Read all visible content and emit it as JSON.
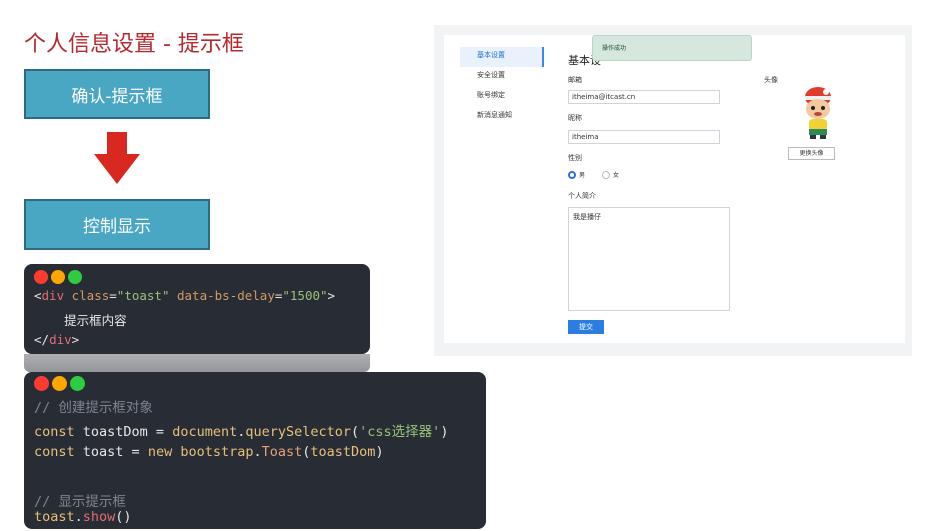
{
  "slide": {
    "title": "个人信息设置 - 提示框",
    "flow_step_1": "确认-提示框",
    "flow_step_2": "控制显示"
  },
  "code_html": {
    "line1_open": "<",
    "line1_tag": "div",
    "line1_attr1": " class",
    "line1_eq1": "=",
    "line1_val1": "\"toast\"",
    "line1_attr2": " data-bs-delay",
    "line1_eq2": "=",
    "line1_val2": "\"1500\"",
    "line1_close": ">",
    "line2": "    提示框内容",
    "line3_open": "</",
    "line3_tag": "div",
    "line3_close": ">"
  },
  "code_js": {
    "comment1": "// 创建提示框对象",
    "l2_kw": "const",
    "l2_var": " toastDom",
    "l2_eq": " = ",
    "l2_obj": "document",
    "l2_dot": ".",
    "l2_fn": "querySelector",
    "l2_p1": "(",
    "l2_str": "'css选择器'",
    "l2_p2": ")",
    "l3_kw": "const",
    "l3_var": " toast",
    "l3_eq": " = ",
    "l3_new": "new",
    "l3_ns": " bootstrap",
    "l3_dot": ".",
    "l3_cls": "Toast",
    "l3_p1": "(",
    "l3_arg": "toastDom",
    "l3_p2": ")",
    "comment2": "// 显示提示框",
    "l6_obj": "toast",
    "l6_dot": ".",
    "l6_fn": "show",
    "l6_call": "()"
  },
  "screenshot": {
    "nav": [
      "基本设置",
      "安全设置",
      "账号绑定",
      "新消息通知"
    ],
    "panel_title": "基本设",
    "toast_text": "操作成功",
    "email_label": "邮箱",
    "email_value": "itheima@itcast.cn",
    "nickname_label": "昵称",
    "nickname_value": "itheima",
    "gender_label": "性别",
    "gender_male": "男",
    "gender_female": "女",
    "gender_selected": "男",
    "bio_label": "个人简介",
    "bio_value": "我是播仔",
    "submit_label": "提交",
    "avatar_label": "头像",
    "change_avatar_label": "更换头像"
  },
  "colors": {
    "title_red": "#b5292e",
    "flow_blue": "#4aa7c4",
    "arrow_red": "#d8281f",
    "code_bg": "#282c34",
    "accent_blue": "#2b7de0"
  }
}
